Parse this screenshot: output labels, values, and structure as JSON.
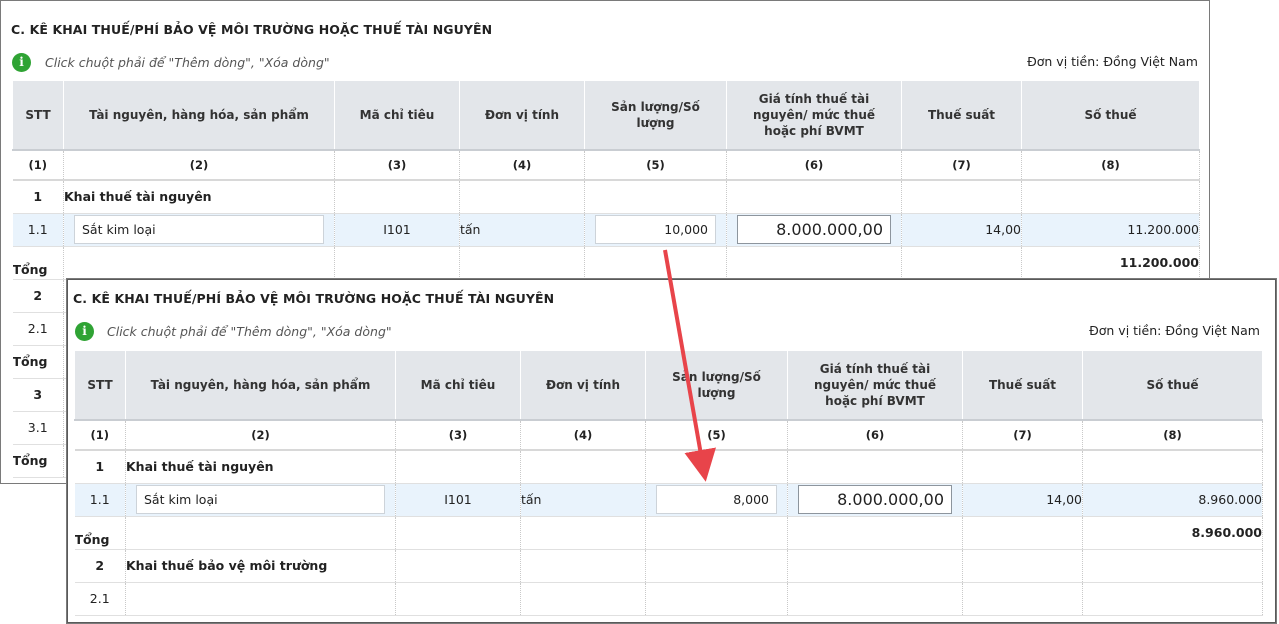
{
  "section_title": "C. KÊ KHAI THUẾ/PHÍ BẢO VỆ MÔI TRƯỜNG HOẶC THUẾ TÀI NGUYÊN",
  "info_icon": "i",
  "hint_text": "Click chuột phải để \"Thêm dòng\", \"Xóa dòng\"",
  "currency_unit": "Đơn vị tiền: Đồng Việt Nam",
  "columns": {
    "stt": "STT",
    "item": "Tài nguyên, hàng hóa, sản phẩm",
    "code": "Mã chỉ tiêu",
    "unit": "Đơn vị tính",
    "qty": "Sản lượng/Số lượng",
    "price": "Giá tính thuế tài nguyên/ mức thuế hoặc phí BVMT",
    "rate": "Thuế suất",
    "tax": "Số thuế"
  },
  "col_numbers": [
    "(1)",
    "(2)",
    "(3)",
    "(4)",
    "(5)",
    "(6)",
    "(7)",
    "(8)"
  ],
  "back": {
    "g1_stt": "1",
    "g1_label": "Khai thuế tài nguyên",
    "r11": {
      "stt": "1.1",
      "item": "Sắt kim loại",
      "code": "I101",
      "unit": "tấn",
      "qty": "10,000",
      "price": "8.000.000,00",
      "rate": "14,00",
      "tax": "11.200.000"
    },
    "total_label": "Tổng",
    "total_value": "11.200.000",
    "g2_stt": "2",
    "r21_stt": "2.1",
    "total2_label": "Tổng",
    "g3_stt": "3",
    "r31_stt": "3.1",
    "total3_label": "Tổng"
  },
  "front": {
    "g1_stt": "1",
    "g1_label": "Khai thuế tài nguyên",
    "r11": {
      "stt": "1.1",
      "item": "Sắt kim loại",
      "code": "I101",
      "unit": "tấn",
      "qty": "8,000",
      "price": "8.000.000,00",
      "rate": "14,00",
      "tax": "8.960.000"
    },
    "total_label": "Tổng",
    "total_value": "8.960.000",
    "g2_stt": "2",
    "g2_label": "Khai thuế bảo vệ môi trường",
    "r21_stt": "2.1"
  },
  "colors": {
    "arrow": "#e8444a",
    "info": "#2fa334",
    "header_bg": "#e3e6ea",
    "row_highlight": "#e9f3fc"
  }
}
